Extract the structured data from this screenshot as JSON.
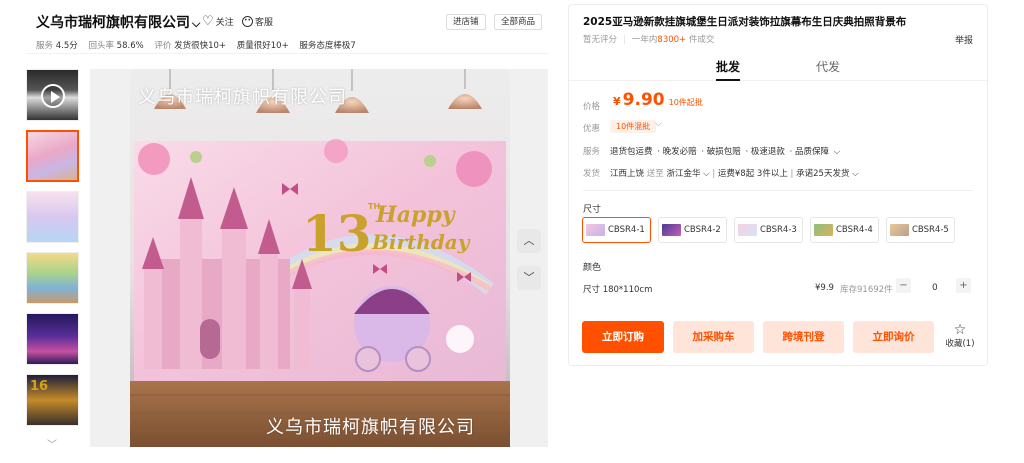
{
  "shop": {
    "name": "义乌市瑞柯旗帜有限公司",
    "follow_label": "关注",
    "service_label": "客服",
    "enter_shop_label": "进店铺",
    "all_goods_label": "全部商品",
    "stats": {
      "service_label": "服务",
      "service_score": "4.5分",
      "reply_label": "回头率",
      "reply_rate": "58.6%",
      "review_label": "评价",
      "tags": [
        "发货很快10+",
        "质量很好10+",
        "服务态度棒极7"
      ]
    }
  },
  "gallery": {
    "thumb_badge": "16",
    "watermark": "义乌市瑞柯旗帜有限公司",
    "banner_text": {
      "number": "13",
      "th": "TH",
      "happy": "Happy",
      "birthday": "Birthday"
    }
  },
  "product": {
    "title": "2025亚马逊新款挂旗城堡生日派对装饰拉旗幕布生日庆典拍照背景布",
    "report_label": "举报",
    "no_rating": "暂无评分",
    "sales_prefix": "一年内",
    "sales_count": "8300+",
    "sales_suffix": "件成交",
    "tabs": [
      "批发",
      "代发"
    ],
    "price_label": "价格",
    "currency": "¥",
    "price": "9.90",
    "moq": "10件起批",
    "promo_label": "优惠",
    "promo_tag": "10件混批",
    "service_label": "服务",
    "services": [
      "退货包运费",
      "晚发必赔",
      "破损包赔",
      "极速退款",
      "品质保障"
    ],
    "ship_label": "发货",
    "ship_from": "江西上饶",
    "ship_to_word": "送至",
    "ship_to": "浙江金华",
    "ship_fee": "运费¥8起",
    "ship_qty": "3件以上",
    "ship_promise": "承诺25天发货",
    "size_label": "尺寸",
    "sizes": [
      "CBSR4-1",
      "CBSR4-2",
      "CBSR4-3",
      "CBSR4-4",
      "CBSR4-5"
    ],
    "color_label": "颜色",
    "spec_row": {
      "name": "尺寸 180*110cm",
      "price": "¥9.9",
      "stock": "库存91692件",
      "qty": "0",
      "minus": "−",
      "plus": "+"
    },
    "actions": {
      "buy": "立即订购",
      "cart": "加采购车",
      "cross_border": "跨境刊登",
      "inquire": "立即询价",
      "favorite": "收藏(1)"
    }
  },
  "colors": {
    "accent": "#ff5000",
    "accent_light": "#ffe4d9"
  }
}
